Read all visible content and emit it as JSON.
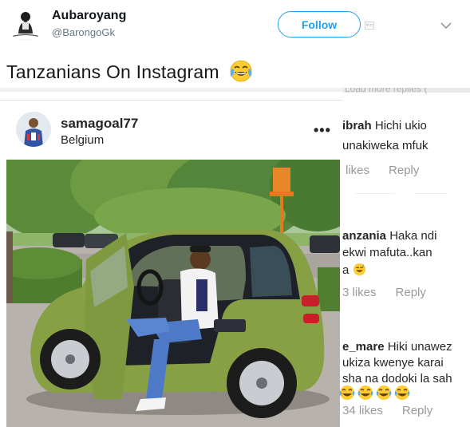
{
  "tweet": {
    "display_name": "Aubaroyang",
    "handle": "@BarongoGk",
    "follow_label": "Follow",
    "text": "Tanzanians On Instagram",
    "emoji": "face-with-tears-of-joy"
  },
  "embedded": {
    "top_cut_text": "Load more replies (",
    "post": {
      "username": "samagoal77",
      "location": "Belgium",
      "more_icon": "more-dots"
    },
    "comments": [
      {
        "user": "ibrah",
        "lines": [
          "Hichi ukio",
          "unakiweka mfuk"
        ],
        "likes": "likes",
        "reply": "Reply"
      },
      {
        "user": "anzania",
        "lines": [
          "Haka ndi",
          "ekwi mafuta..kan",
          "a"
        ],
        "likes": "3 likes",
        "reply": "Reply"
      },
      {
        "user": "e_mare",
        "lines": [
          "Hiki unawez",
          "ukiza kwenye karai",
          "sha na dodoki la sah"
        ],
        "likes": "34 likes",
        "reply": "Reply"
      }
    ]
  },
  "colors": {
    "accent": "#1da1f2",
    "text": "#14171a",
    "muted": "#657786",
    "ig_muted": "#999999",
    "car_green": "#8aa24a"
  }
}
